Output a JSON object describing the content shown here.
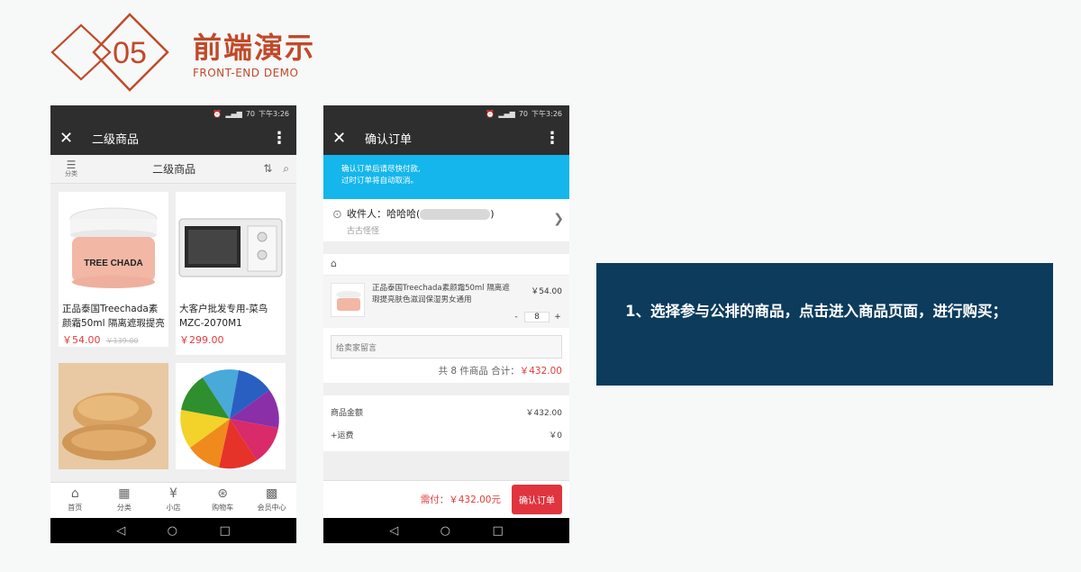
{
  "header": {
    "number": "05",
    "title": "前端演示",
    "subtitle": "FRONT-END  DEMO"
  },
  "status": {
    "time": "下午3:26",
    "battery": "70"
  },
  "phone1": {
    "title": "二级商品",
    "subhead": {
      "category_label": "分类",
      "title": "二级商品"
    },
    "products": [
      {
        "name": "正品泰国Treechada素颜霜50ml 隔离遮瑕提亮肤",
        "price": "￥54.00",
        "old_price": "￥139.00",
        "brand": "TREE CHADA"
      },
      {
        "name": "大客户批发专用-菜鸟MZC-2070M1",
        "price": "￥299.00",
        "old_price": ""
      },
      {
        "name": "",
        "price": "",
        "old_price": ""
      },
      {
        "name": "",
        "price": "",
        "old_price": ""
      }
    ],
    "tabs": [
      {
        "label": "首页",
        "icon": "home-icon"
      },
      {
        "label": "分类",
        "icon": "grid-icon"
      },
      {
        "label": "小店",
        "icon": "shop-icon"
      },
      {
        "label": "购物车",
        "icon": "cart-icon"
      },
      {
        "label": "会员中心",
        "icon": "qr-icon"
      }
    ]
  },
  "phone2": {
    "title": "确认订单",
    "notice": [
      "确认订单后请尽快付款,",
      "过时订单将自动取消。"
    ],
    "receiver": {
      "label": "收件人：哈哈哈(",
      "suffix": ")",
      "location": "古古怪怪"
    },
    "item": {
      "name": "正品泰国Treechada素颜霜50ml 隔离遮瑕提亮肤色滋润保湿男女通用",
      "price": "￥54.00",
      "qty": "8",
      "minus": "-",
      "plus": "+"
    },
    "message_placeholder": "给卖家留言",
    "summary": {
      "prefix": "共 8 件商品  合计：",
      "total": "￥432.00"
    },
    "totals": [
      {
        "label": "商品金额",
        "value": "￥432.00"
      },
      {
        "label": "+运费",
        "value": "￥0"
      }
    ],
    "pay": {
      "need": "需付：￥432.00元",
      "button": "确认订单"
    }
  },
  "info": {
    "text": "1、选择参与公排的商品，点击进入商品页面，进行购买；"
  },
  "colors": {
    "accent": "#c04a2a",
    "dark_bar": "#2e2e2e",
    "notice": "#15b6ec",
    "price_red": "#e43b3b",
    "info_bg": "#0c3b5c"
  }
}
